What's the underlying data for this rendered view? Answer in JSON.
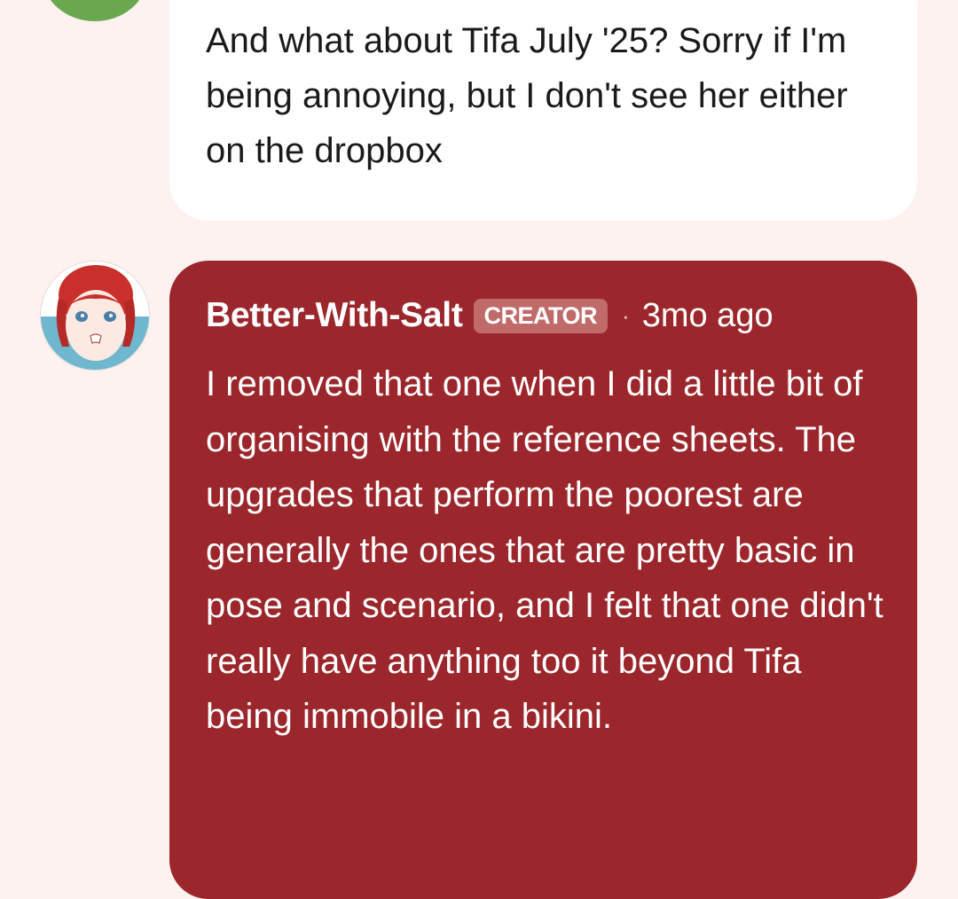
{
  "previous_comment": {
    "text": "And what about Tifa July '25? Sorry if I'm being annoying, but I don't see her either on the dropbox"
  },
  "creator_reply": {
    "author": "Better-With-Salt",
    "badge": "CREATOR",
    "separator": "·",
    "timestamp": "3mo ago",
    "text": "I removed that one when I did a little bit of organising with the reference sheets. The upgrades that perform the poorest are generally the ones that are pretty basic in pose and scenario, and I felt that one didn't really have anything too it beyond Tifa being immobile in a bikini."
  },
  "colors": {
    "page_background": "#fdf2f0",
    "creator_bubble": "#9b262b",
    "badge_background": "#c06a6a",
    "comment_bubble": "#ffffff",
    "previous_avatar": "#6aa84f"
  },
  "icons": {
    "creator_avatar": "avatar-icon",
    "previous_avatar": "avatar-icon"
  }
}
